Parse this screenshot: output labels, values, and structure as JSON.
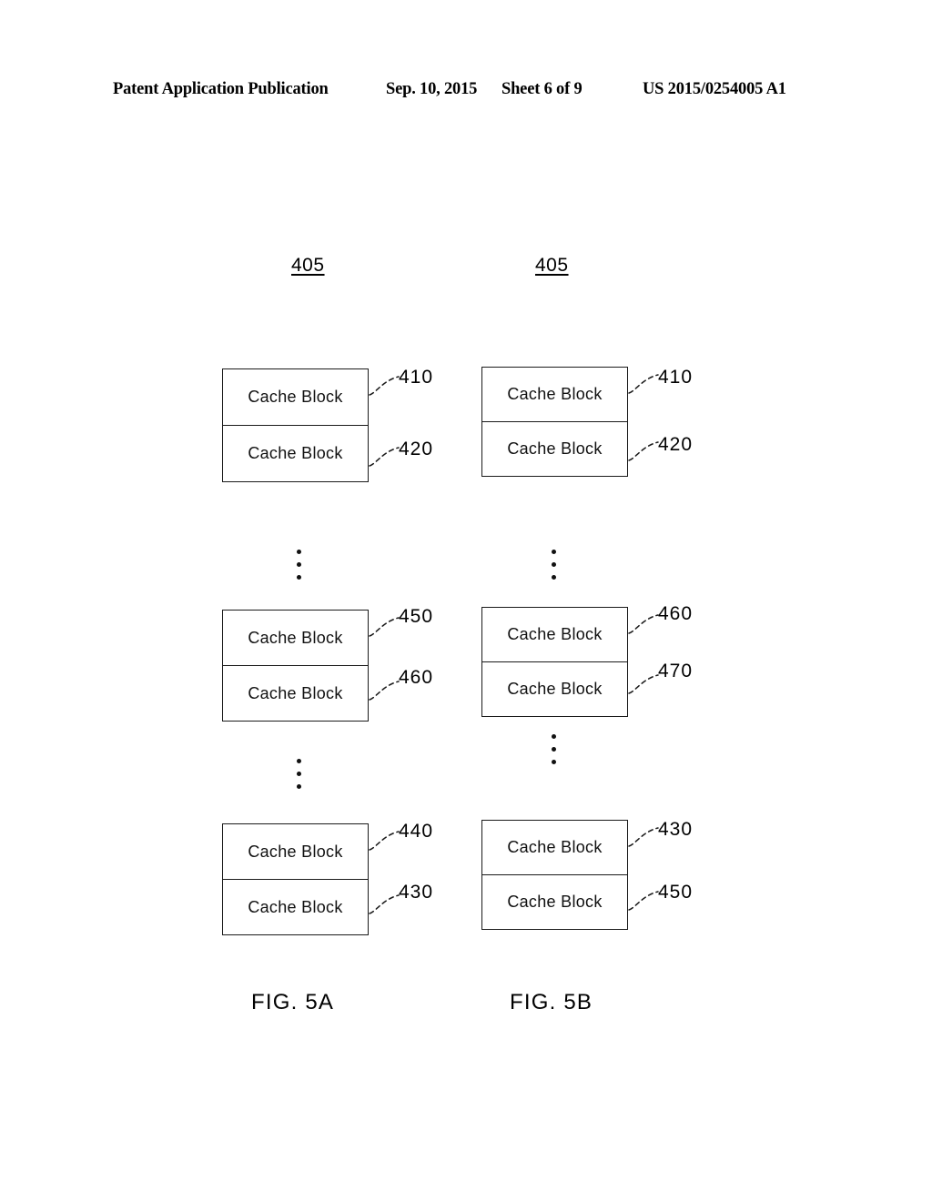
{
  "header": {
    "left": "Patent Application Publication",
    "date": "Sep. 10, 2015",
    "sheet": "Sheet 6 of 9",
    "publication_number": "US 2015/0254005 A1"
  },
  "block_label": "Cache Block",
  "figures": [
    {
      "id": "5a",
      "caption": "FIG. 5A",
      "top_ref": "405",
      "groups": [
        {
          "upper_ref": "410",
          "lower_ref": "420"
        },
        {
          "upper_ref": "450",
          "lower_ref": "460"
        },
        {
          "upper_ref": "440",
          "lower_ref": "430"
        }
      ]
    },
    {
      "id": "5b",
      "caption": "FIG. 5B",
      "top_ref": "405",
      "groups": [
        {
          "upper_ref": "410",
          "lower_ref": "420"
        },
        {
          "upper_ref": "460",
          "lower_ref": "470"
        },
        {
          "upper_ref": "430",
          "lower_ref": "450"
        }
      ]
    }
  ]
}
